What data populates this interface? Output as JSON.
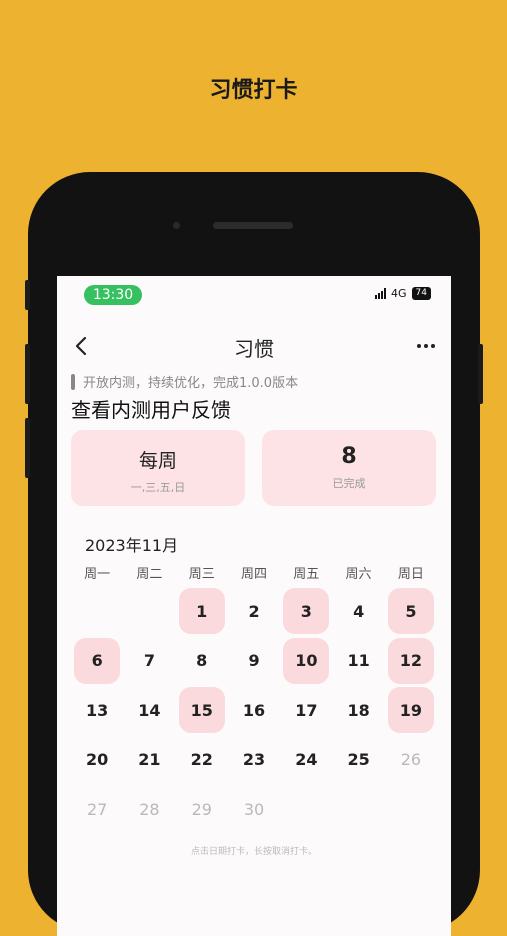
{
  "headline": "习惯打卡",
  "status_bar": {
    "time": "13:30",
    "network": "4G",
    "battery": "74"
  },
  "nav": {
    "title": "习惯"
  },
  "notice": "开放内测，持续优化，完成1.0.0版本",
  "habit_title": "查看内测用户反馈",
  "frequency_card": {
    "main": "每周",
    "sub": "一,三,五,日"
  },
  "completed_card": {
    "value": "8",
    "label": "已完成"
  },
  "calendar": {
    "month_label": "2023年11月",
    "weekdays": [
      "周一",
      "周二",
      "周三",
      "周四",
      "周五",
      "周六",
      "周日"
    ],
    "weeks": [
      [
        {
          "d": ""
        },
        {
          "d": ""
        },
        {
          "d": "1",
          "checked": true
        },
        {
          "d": "2"
        },
        {
          "d": "3",
          "checked": true
        },
        {
          "d": "4"
        },
        {
          "d": "5",
          "checked": true
        }
      ],
      [
        {
          "d": "6",
          "checked": true
        },
        {
          "d": "7"
        },
        {
          "d": "8"
        },
        {
          "d": "9"
        },
        {
          "d": "10",
          "checked": true
        },
        {
          "d": "11"
        },
        {
          "d": "12",
          "checked": true
        }
      ],
      [
        {
          "d": "13"
        },
        {
          "d": "14"
        },
        {
          "d": "15",
          "checked": true
        },
        {
          "d": "16"
        },
        {
          "d": "17"
        },
        {
          "d": "18"
        },
        {
          "d": "19",
          "checked": true
        }
      ],
      [
        {
          "d": "20"
        },
        {
          "d": "21"
        },
        {
          "d": "22"
        },
        {
          "d": "23"
        },
        {
          "d": "24"
        },
        {
          "d": "25"
        },
        {
          "d": "26",
          "other": true
        }
      ],
      [
        {
          "d": "27",
          "other": true
        },
        {
          "d": "28",
          "other": true
        },
        {
          "d": "29",
          "other": true
        },
        {
          "d": "30",
          "other": true
        },
        {
          "d": ""
        },
        {
          "d": ""
        },
        {
          "d": ""
        }
      ]
    ]
  },
  "hint": "点击日期打卡，长按取消打卡。",
  "colors": {
    "background": "#EDB22F",
    "checked": "#FADADD",
    "card": "#FDE3E5",
    "time_pill": "#37C05F"
  }
}
